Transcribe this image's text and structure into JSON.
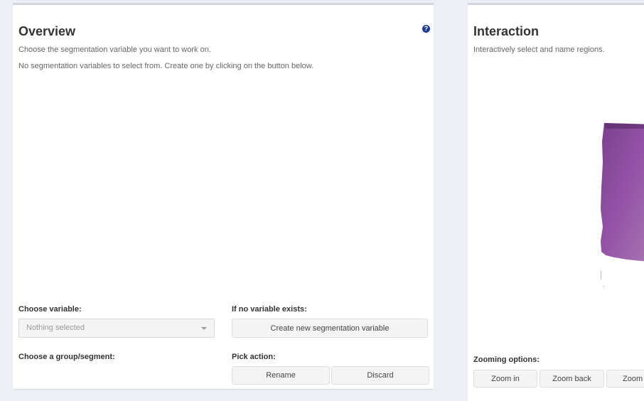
{
  "overview": {
    "title": "Overview",
    "help_icon": "question-circle-icon",
    "help_glyph": "?",
    "description": "Choose the segmentation variable you want to work on.",
    "no_variables_text": "No segmentation variables to select from. Create one by clicking on the button below.",
    "choose_variable_label": "Choose variable:",
    "variable_select": {
      "value": "Nothing selected"
    },
    "no_variable_label": "If no variable exists:",
    "create_button": "Create new segmentation variable",
    "choose_group_label": "Choose a group/segment:",
    "pick_action_label": "Pick action:",
    "rename_button": "Rename",
    "discard_button": "Discard"
  },
  "interaction": {
    "title": "Interaction",
    "description": "Interactively select and name regions.",
    "zooming_label": "Zooming options:",
    "zoom_in_button": "Zoom in",
    "zoom_back_button": "Zoom back",
    "zoom_out_button": "Zoom out"
  },
  "colors": {
    "background": "#ecf0f5",
    "tissue": "#8a4a9e",
    "help_icon": "#1f3a93"
  }
}
